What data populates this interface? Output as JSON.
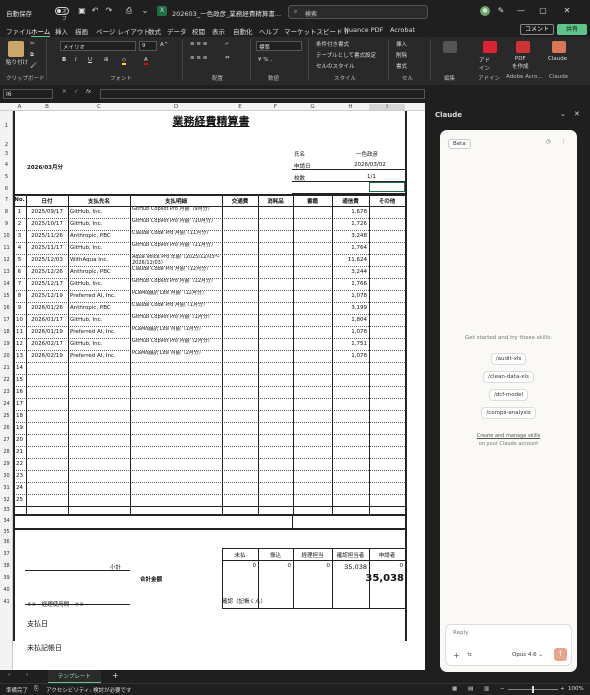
{
  "titlebar": {
    "autosave": "自動保存",
    "toggle": "オフ",
    "filename": "202603_一色政彦_業務経費精算書...",
    "search": "検索"
  },
  "tabs": [
    "ファイル",
    "ホーム",
    "挿入",
    "描画",
    "ページ レイアウト",
    "数式",
    "データ",
    "校閲",
    "表示",
    "自動化",
    "ヘルプ",
    "マーケットスピード II",
    "Nuance PDF",
    "Acrobat"
  ],
  "header_buttons": {
    "comment": "コメント",
    "share": "共有"
  },
  "ribbon": {
    "paste": "貼り付け",
    "font_name": "メイリオ",
    "font_size": "9",
    "number_format": "標準",
    "cond_format": "条件付き書式",
    "table_format": "テーブルとして書式設定",
    "cell_style": "セルのスタイル",
    "insert": "挿入",
    "delete": "削除",
    "format": "書式",
    "edit": "編集",
    "addin": "アド\nイン",
    "pdf": "PDF\nを作成",
    "claude": "Claude",
    "groups": [
      "クリップボード",
      "フォント",
      "配置",
      "数値",
      "スタイル",
      "セル",
      "編集",
      "アドイン",
      "Adobe Acro...",
      "Claude"
    ]
  },
  "formula": {
    "namebox": "I6",
    "fx": "fx",
    "value": ""
  },
  "columns": [
    "A",
    "B",
    "C",
    "D",
    "E",
    "F",
    "G",
    "H",
    "I"
  ],
  "sheet": {
    "title": "業務経費精算書",
    "month": "2026/03月分",
    "name_label": "氏名",
    "name_value": "一色政彦",
    "date_label": "申請日",
    "date_value": "2026/03/02",
    "pages_label": "枚数",
    "pages_value": "1/1",
    "headers": [
      "No.",
      "日付",
      "支払先名",
      "支払明細",
      "交通費",
      "消耗品",
      "書籍",
      "通信費",
      "その他"
    ],
    "rows": [
      [
        "1",
        "2025/09/17",
        "GitHub, Inc.",
        "GitHub Copilot Pro 月額（9月分）",
        "1,678"
      ],
      [
        "2",
        "2025/10/17",
        "GitHub, Inc.",
        "GitHub Copilot Pro 月額（10月分）",
        "1,726"
      ],
      [
        "3",
        "2025/11/26",
        "Anthropic, PBC",
        "Claude Code Pro 月額（11月分）",
        "3,248"
      ],
      [
        "4",
        "2025/11/17",
        "GitHub, Inc.",
        "GitHub Copilot Pro 月額（11月分）",
        "1,764"
      ],
      [
        "5",
        "2025/12/03",
        "WithAqua Inc.",
        "Aqua Voice Pro 年額（2025/12/03～2026/12/03）",
        "11,624"
      ],
      [
        "6",
        "2025/12/26",
        "Anthropic, PBC",
        "Claude Code Pro 月額（12月分）",
        "3,244"
      ],
      [
        "7",
        "2025/12/17",
        "GitHub, Inc.",
        "GitHub Copilot Pro 月額（12月分）",
        "1,766"
      ],
      [
        "8",
        "2025/12/19",
        "Preferred AI, Inc.",
        "PLaMo翻訳 Lite 月額（12月分）",
        "1,078"
      ],
      [
        "9",
        "2026/01/26",
        "Anthropic, PBC",
        "Claude Code Pro 月額（1月分）",
        "3,199"
      ],
      [
        "10",
        "2026/01/17",
        "GitHub, Inc.",
        "GitHub Copilot Pro 月額（1月分）",
        "1,804"
      ],
      [
        "11",
        "2026/01/19",
        "Preferred AI, Inc.",
        "PLaMo翻訳 Lite 月額（1月分）",
        "1,078"
      ],
      [
        "12",
        "2026/02/17",
        "GitHub, Inc.",
        "GitHub Copilot Pro 月額（2月分）",
        "1,751"
      ],
      [
        "13",
        "2026/02/19",
        "Preferred AI, Inc.",
        "PLaMo翻訳 Lite 月額（2月分）",
        "1,078"
      ]
    ],
    "subtotal_label": "小計",
    "subtotals": [
      "0",
      "0",
      "0",
      "35,038",
      "0"
    ],
    "total_label": "合計金額",
    "total_value": "35,038",
    "accounting": "※※　経理使用欄　※※",
    "pay_date": "支払日",
    "unpaid_date": "未払記帳日",
    "confirm_title": "確認（記帳くん）",
    "confirm_cols": [
      "未払",
      "振込",
      "経理担当",
      "確認担当者",
      "申請者"
    ]
  },
  "sheet_tab": "テンプレート",
  "status": {
    "ready": "準備完了",
    "accessibility": "アクセシビリティ: 検討が必要です",
    "zoom": "100%"
  },
  "claude": {
    "title": "Claude",
    "beta": "Beta",
    "prompt": "Get started and try these skills:",
    "skills": [
      "/audit-xls",
      "/clean-data-xls",
      "/dcf-model",
      "/comps-analysis"
    ],
    "link1": "Create and manage skills",
    "link2": "on your Claude account",
    "reply": "Reply",
    "model": "Opus 4.6"
  }
}
